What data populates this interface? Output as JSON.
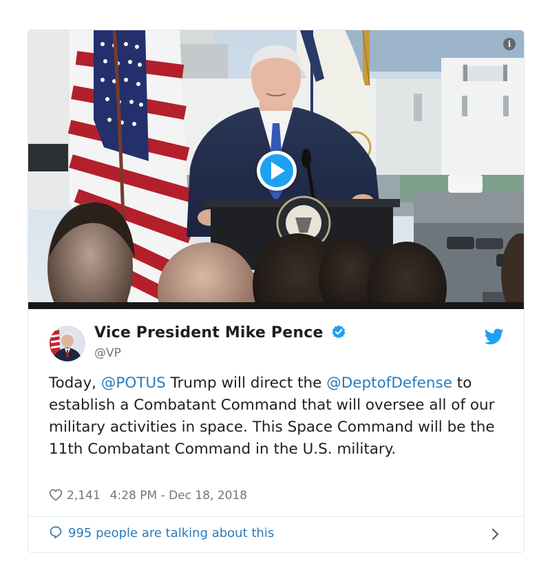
{
  "tweet": {
    "display_name": "Vice President Mike Pence",
    "handle": "@VP",
    "text_parts": [
      "Today, ",
      "@POTUS",
      " Trump will direct the ",
      "@DeptofDefense",
      " to establish a Combatant Command that will oversee all of our military activities in space. This Space Command will be the 11th Combatant Command in the U.S. military."
    ],
    "likes": "2,141",
    "timestamp": "4:28 PM - Dec 18, 2018",
    "conversation_link": "995 people are talking about this"
  },
  "media": {
    "info_label": "i",
    "play_icon": "play-icon"
  },
  "colors": {
    "twitter_blue": "#1da1f2",
    "link_blue": "#2b7bb9",
    "meta_gray": "#697882",
    "border": "#e1e8ed"
  }
}
